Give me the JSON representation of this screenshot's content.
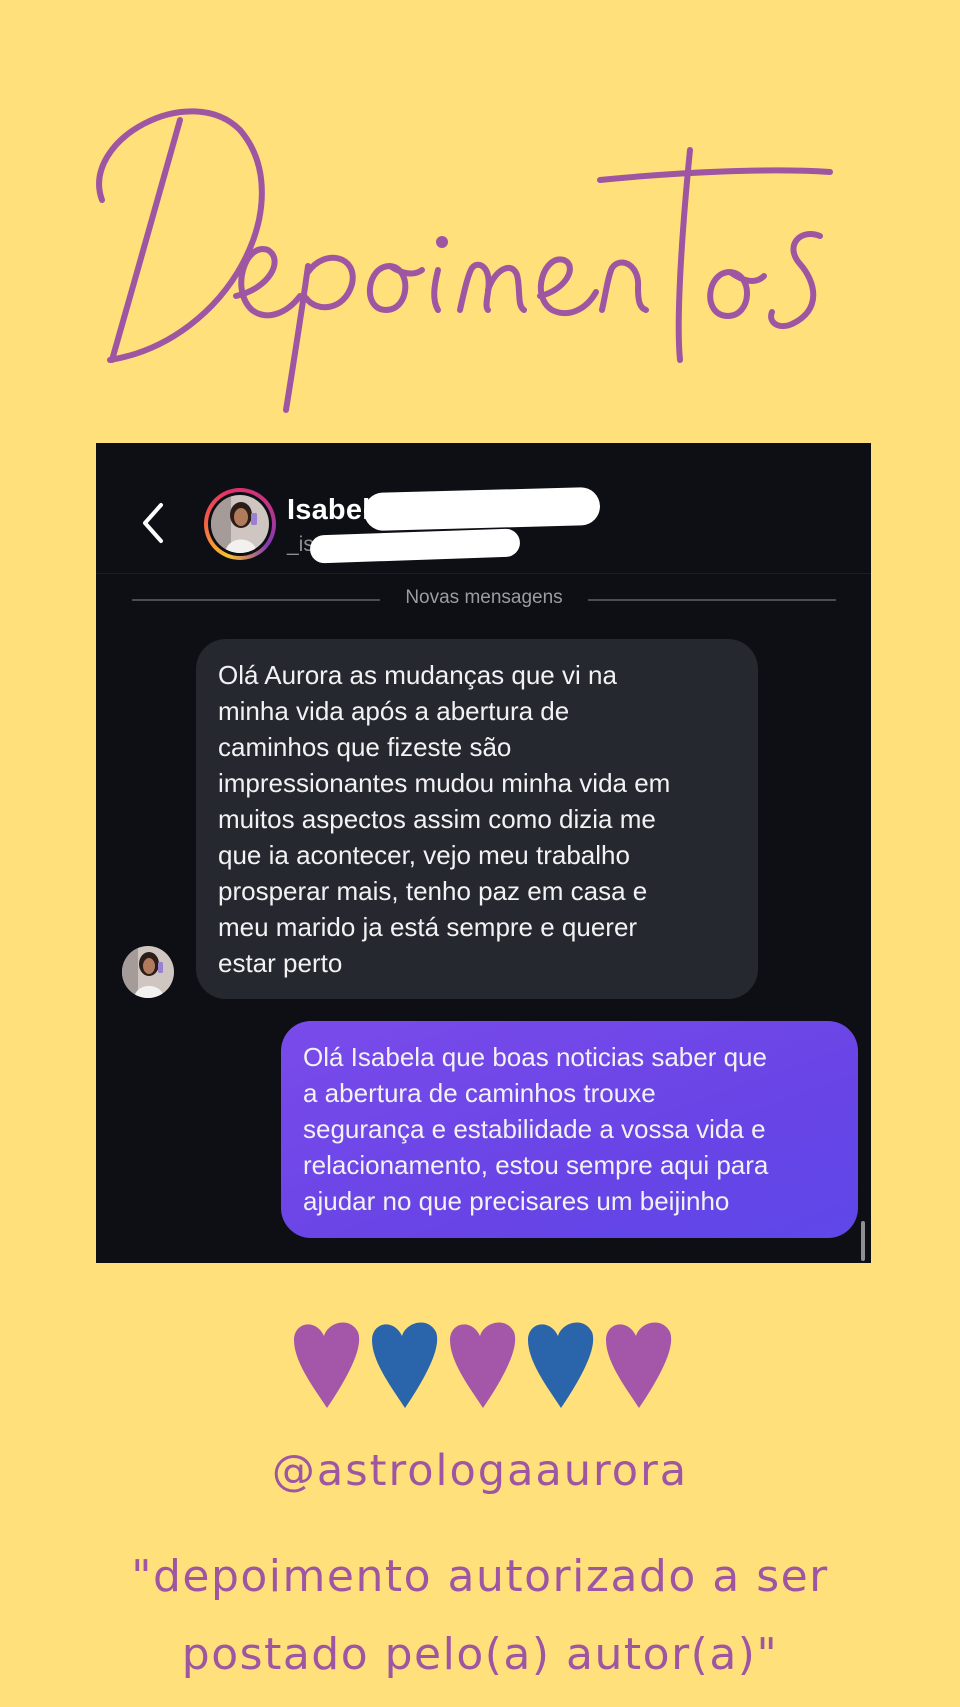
{
  "colors": {
    "background": "#FFE07A",
    "accent_purple": "#9E56A3",
    "heart_purple": "#A456A8",
    "heart_blue": "#2A64AA",
    "chat_background": "#0D0F14",
    "received_bubble": "#26282F",
    "sent_bubble": "#6944E6"
  },
  "title": "Depoimentos",
  "chat": {
    "header": {
      "back_icon": "chevron-left-icon",
      "contact_name": "Isabel",
      "contact_username": "_is"
    },
    "divider_label": "Novas mensagens",
    "messages": [
      {
        "direction": "received",
        "text": "Olá Aurora as mudanças que vi na\nminha vida após a abertura de\ncaminhos que fizeste são\nimpressionantes mudou minha vida em\nmuitos aspectos assim como dizia me\nque ia acontecer, vejo meu trabalho\nprosperar mais, tenho paz em casa e\nmeu marido ja está sempre e querer\nestar perto"
      },
      {
        "direction": "sent",
        "text": "Olá Isabela que boas noticias saber que\na abertura de caminhos trouxe\nsegurança e estabilidade a vossa vida e\nrelacionamento, estou sempre aqui para\najudar no que precisares um beijinho"
      }
    ]
  },
  "hearts": [
    {
      "icon": "heart-icon",
      "color": "#A456A8"
    },
    {
      "icon": "heart-icon",
      "color": "#2A64AA"
    },
    {
      "icon": "heart-icon",
      "color": "#A456A8"
    },
    {
      "icon": "heart-icon",
      "color": "#2A64AA"
    },
    {
      "icon": "heart-icon",
      "color": "#A456A8"
    }
  ],
  "handle": "@astrologaaurora",
  "disclaimer": "\"depoimento autorizado a ser\npostado pelo(a) autor(a)\""
}
